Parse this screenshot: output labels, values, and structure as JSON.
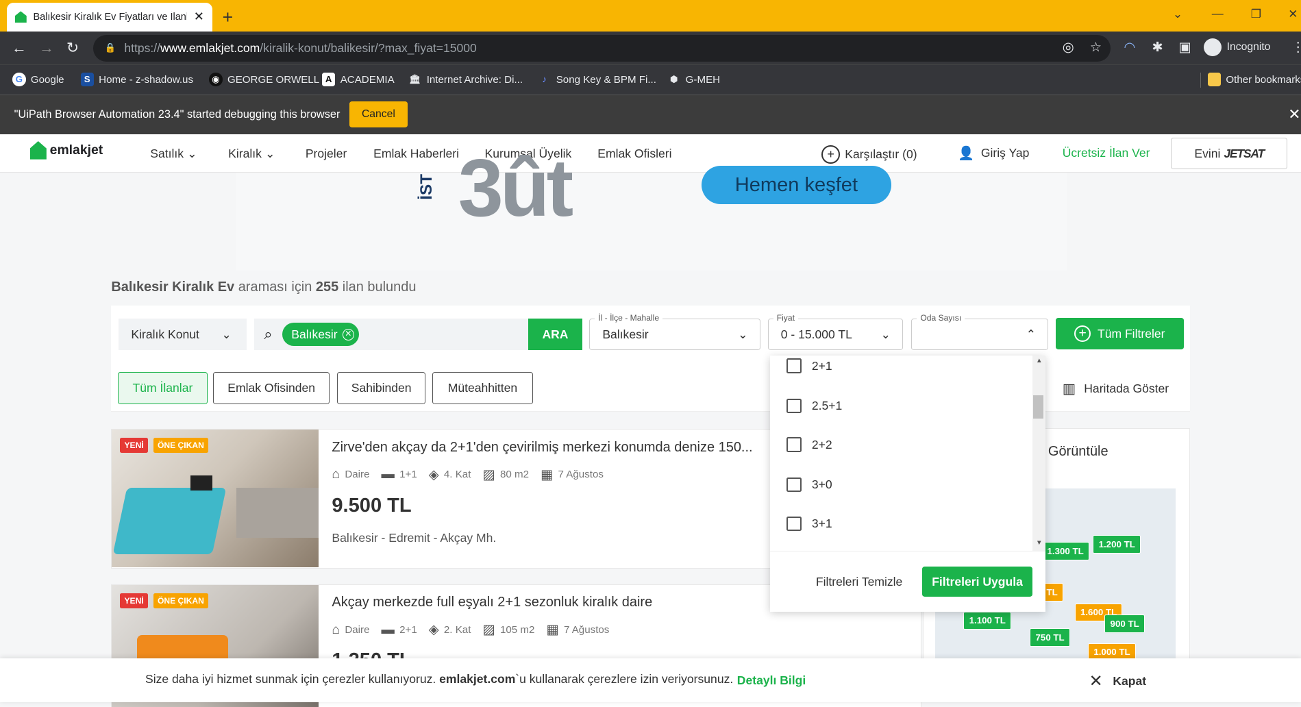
{
  "browser": {
    "tab_title": "Balıkesir Kiralık Ev Fiyatları ve İlanları",
    "url_pre": "https://",
    "url_host": "www.emlakjet.com",
    "url_path": "/kiralik-konut/balikesir/?max_fiyat=15000",
    "incognito": "Incognito"
  },
  "bookmarks": [
    {
      "label": "Google"
    },
    {
      "label": "Home - z-shadow.us"
    },
    {
      "label": "GEORGE ORWELL"
    },
    {
      "label": "ACADEMIA"
    },
    {
      "label": "Internet Archive: Di..."
    },
    {
      "label": "Song Key & BPM Fi..."
    },
    {
      "label": "G-MEH"
    }
  ],
  "other_bookmarks": "Other bookmarks",
  "debug": {
    "message": "\"UiPath Browser Automation 23.4\" started debugging this browser",
    "cancel": "Cancel"
  },
  "site": {
    "logo": "emlakjet",
    "menu": [
      "Satılık",
      "Kiralık",
      "Projeler",
      "Emlak Haberleri",
      "Kurumsal Üyelik",
      "Emlak Ofisleri"
    ],
    "compare": "Karşılaştır (0)",
    "login": "Giriş Yap",
    "free_ad": "Ücretsiz İlan Ver",
    "sell_pre": "Evini",
    "sell_brand": "JETSAT"
  },
  "banner": {
    "ist": "İST",
    "big": "3ût",
    "cta": "Hemen keşfet"
  },
  "results": {
    "place": "Balıkesir Kiralık Ev",
    "mid": " araması için ",
    "count": "255",
    "post": " ilan bulundu"
  },
  "filters": {
    "type": "Kiralık Konut",
    "chip": "Balıkesir",
    "search_btn": "ARA",
    "loc_label": "İl - İlçe - Mahalle",
    "loc_value": "Balıkesir",
    "price_label": "Fiyat",
    "price_value": "0 - 15.000 TL",
    "room_label": "Oda Sayısı",
    "room_value": "",
    "all_filters": "Tüm Filtreler",
    "tabs": [
      "Tüm İlanlar",
      "Emlak Ofisinden",
      "Sahibinden",
      "Müteahhitten"
    ],
    "map": "Haritada Göster"
  },
  "room_options": [
    "2+1",
    "2.5+1",
    "2+2",
    "3+0",
    "3+1"
  ],
  "dropdown": {
    "clear": "Filtreleri Temizle",
    "apply": "Filtreleri Uygula"
  },
  "listings": [
    {
      "tag_new": "YENİ",
      "tag_featured": "ÖNE ÇIKAN",
      "title": "Zirve'den akçay da 2+1'den çevirilmiş merkezi konumda denize 150...",
      "type": "Daire",
      "rooms": "1+1",
      "floor": "4. Kat",
      "area": "80 m2",
      "date": "7 Ağustos",
      "price": "9.500 TL",
      "location": "Balıkesir - Edremit - Akçay Mh."
    },
    {
      "tag_new": "YENİ",
      "tag_featured": "ÖNE ÇIKAN",
      "title": "Akçay merkezde full eşyalı 2+1 sezonluk kiralık daire",
      "type": "Daire",
      "rooms": "2+1",
      "floor": "2. Kat",
      "area": "105 m2",
      "date": "7 Ağustos",
      "price": "1.250 TL",
      "location": ""
    }
  ],
  "map_side": {
    "title": "Görüntüle",
    "pins": [
      "1.300 TL",
      "1.200 TL",
      "0 TL",
      "1.600 TL",
      "1.100 TL",
      "900 TL",
      "750 TL",
      "1.000 TL"
    ]
  },
  "cookie": {
    "message_pre": "Size daha iyi hizmet sunmak için çerezler kullanıyoruz. ",
    "site": "emlakjet.com",
    "message_post": "`u kullanarak çerezlere izin veriyorsunuz.",
    "details": "Detaylı Bilgi",
    "close": "Kapat"
  },
  "colors": {
    "brand_green": "#1bb34b",
    "browser_accent": "#f8b502"
  }
}
